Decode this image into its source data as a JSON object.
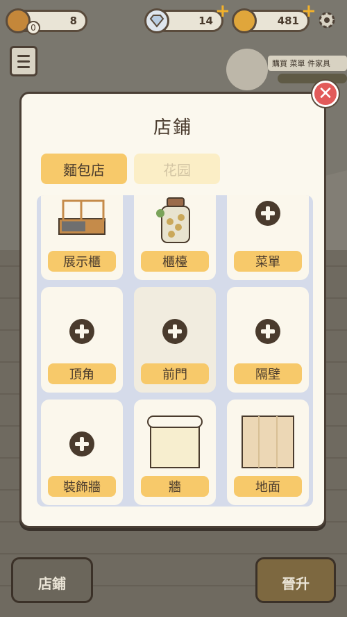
{
  "hud": {
    "bread_count": "8",
    "bread_badge": "0",
    "diamonds": "14",
    "coins": "481"
  },
  "npc": {
    "speech": "購買 菜單 件家具"
  },
  "modal": {
    "title": "店鋪",
    "tabs": [
      {
        "label": "麵包店",
        "active": true
      },
      {
        "label": "花园",
        "active": false
      }
    ],
    "items": [
      {
        "label": "展示櫃",
        "icon": "display-case-icon"
      },
      {
        "label": "櫃檯",
        "icon": "jar-counter-icon"
      },
      {
        "label": "菜單",
        "icon": "plus-icon"
      },
      {
        "label": "頂角",
        "icon": "plus-icon"
      },
      {
        "label": "前門",
        "icon": "plus-icon"
      },
      {
        "label": "隔壁",
        "icon": "plus-icon"
      },
      {
        "label": "裝飾牆",
        "icon": "plus-icon"
      },
      {
        "label": "牆",
        "icon": "wallpaper-icon"
      },
      {
        "label": "地面",
        "icon": "floor-wood-icon"
      }
    ]
  },
  "bottom": {
    "shop_label": "店鋪",
    "upgrade_label": "晉升"
  },
  "colors": {
    "accent": "#f7c96a",
    "close": "#e25a5a",
    "panel": "#fbf8ee"
  }
}
